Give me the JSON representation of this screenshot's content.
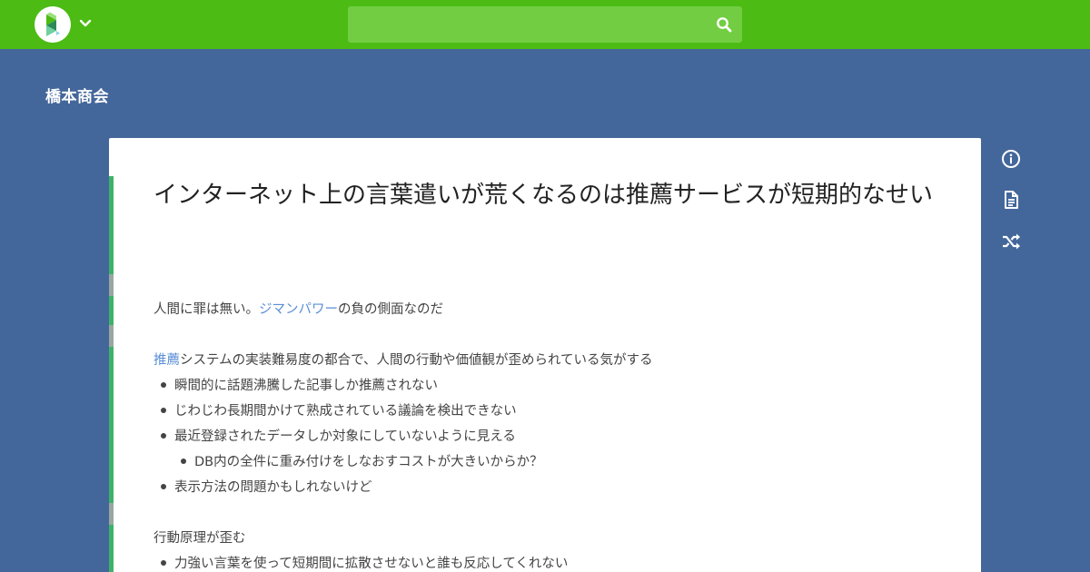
{
  "header": {
    "search_placeholder": "",
    "brand_color": "#4cbb14"
  },
  "project": {
    "name": "橋本商会"
  },
  "page": {
    "title": "インターネット上の言葉遣いが荒くなるのは推薦サービスが短期的なせい",
    "lines": [
      {
        "segments": [
          {
            "text": "人間に罪は無い。",
            "link": false
          },
          {
            "text": "ジマンパワー",
            "link": true
          },
          {
            "text": "の負の側面なのだ",
            "link": false
          }
        ]
      },
      {
        "segments": [
          {
            "text": "推薦",
            "link": true
          },
          {
            "text": "システムの実装難易度の都合で、人間の行動や価値観が歪められている気がする",
            "link": false
          }
        ]
      },
      {
        "text": "瞬間的に話題沸騰した記事しか推薦されない"
      },
      {
        "text": "じわじわ長期間かけて熟成されている議論を検出できない"
      },
      {
        "text": "最近登録されたデータしか対象にしていないように見える"
      },
      {
        "text": "DB内の全件に重み付けをしなおすコストが大きいからか？"
      },
      {
        "text": "表示方法の問題かもしれないけど"
      },
      {
        "text": "行動原理が歪む"
      },
      {
        "text": "力強い言葉を使って短期間に拡散させないと誰も反応してくれない"
      }
    ]
  },
  "sidebar_icons": [
    "info-icon",
    "document-icon",
    "shuffle-icon"
  ],
  "colors": {
    "background": "#44679b",
    "link": "#5a8fd6",
    "line_bar": "#3fb26a"
  }
}
